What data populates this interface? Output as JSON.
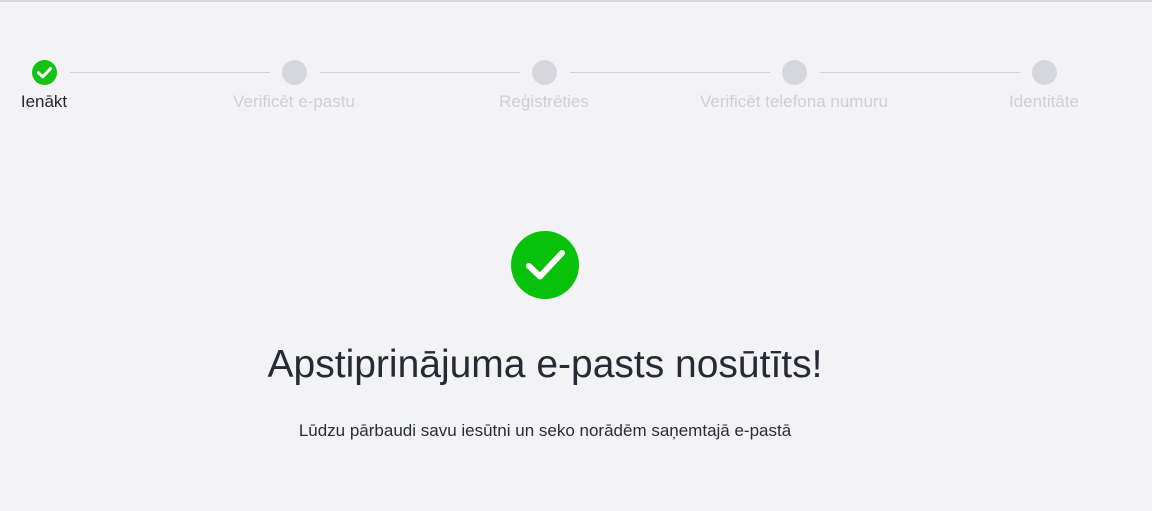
{
  "stepper": {
    "steps": [
      {
        "label": "Ienākt",
        "status": "done"
      },
      {
        "label": "Verificēt e-pastu",
        "status": "pending"
      },
      {
        "label": "Reģistrēties",
        "status": "pending"
      },
      {
        "label": "Verificēt telefona numuru",
        "status": "pending"
      },
      {
        "label": "Identitāte",
        "status": "pending"
      }
    ]
  },
  "confirmation": {
    "icon": "check-circle-icon",
    "title": "Apstiprinājuma e-pasts nosūtīts!",
    "message": "Lūdzu pārbaudi savu iesūtni un seko norādēm saņemtajā e-pastā"
  },
  "colors": {
    "success": "#13c313",
    "pending": "#d6d7dc",
    "background": "#f3f3f5",
    "text": "#23262f",
    "muted_text": "#cfd0d4"
  }
}
